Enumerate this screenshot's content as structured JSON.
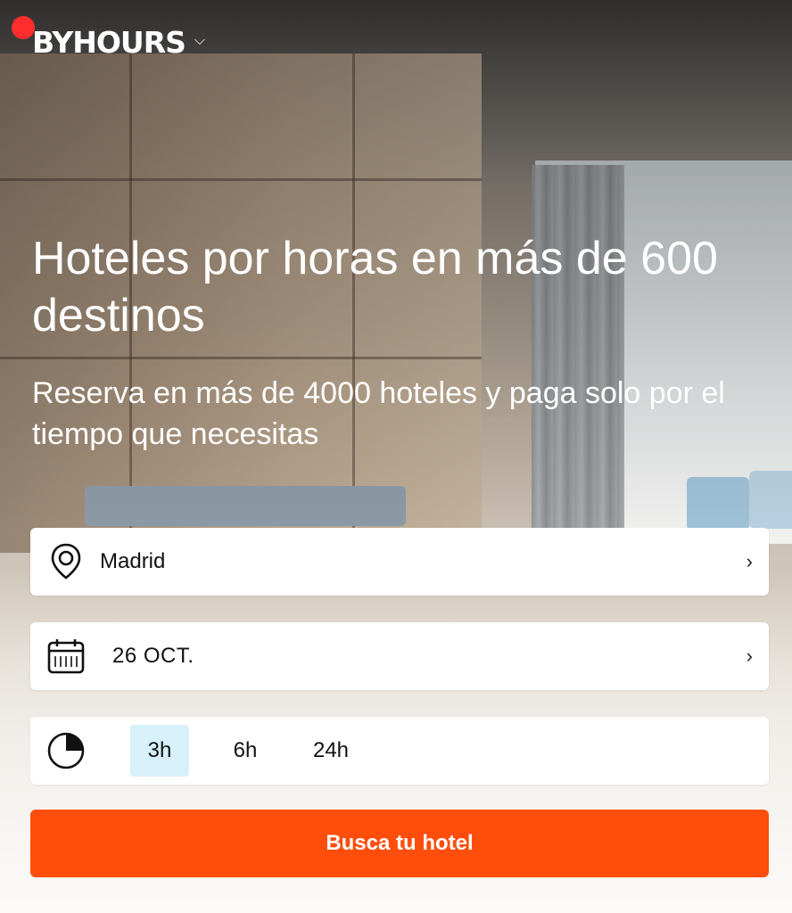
{
  "header": {
    "logo_text": "BYHOURS"
  },
  "hero": {
    "title": "Hoteles por horas en más de 600 destinos",
    "subtitle": "Reserva en más de 4000 hoteles y paga solo por el tiempo que necesitas"
  },
  "form": {
    "location": {
      "value": "Madrid",
      "icon": "location-pin-icon"
    },
    "date": {
      "value": "26 OCT.",
      "icon": "calendar-icon"
    },
    "duration": {
      "icon": "clock-icon",
      "options": [
        "3h",
        "6h",
        "24h"
      ],
      "selected": "3h"
    },
    "search_button_label": "Busca tu hotel"
  },
  "colors": {
    "accent": "#ff4d0b",
    "selected_duration_bg": "#d7f1fb",
    "notification_dot": "#ff2d2d"
  }
}
